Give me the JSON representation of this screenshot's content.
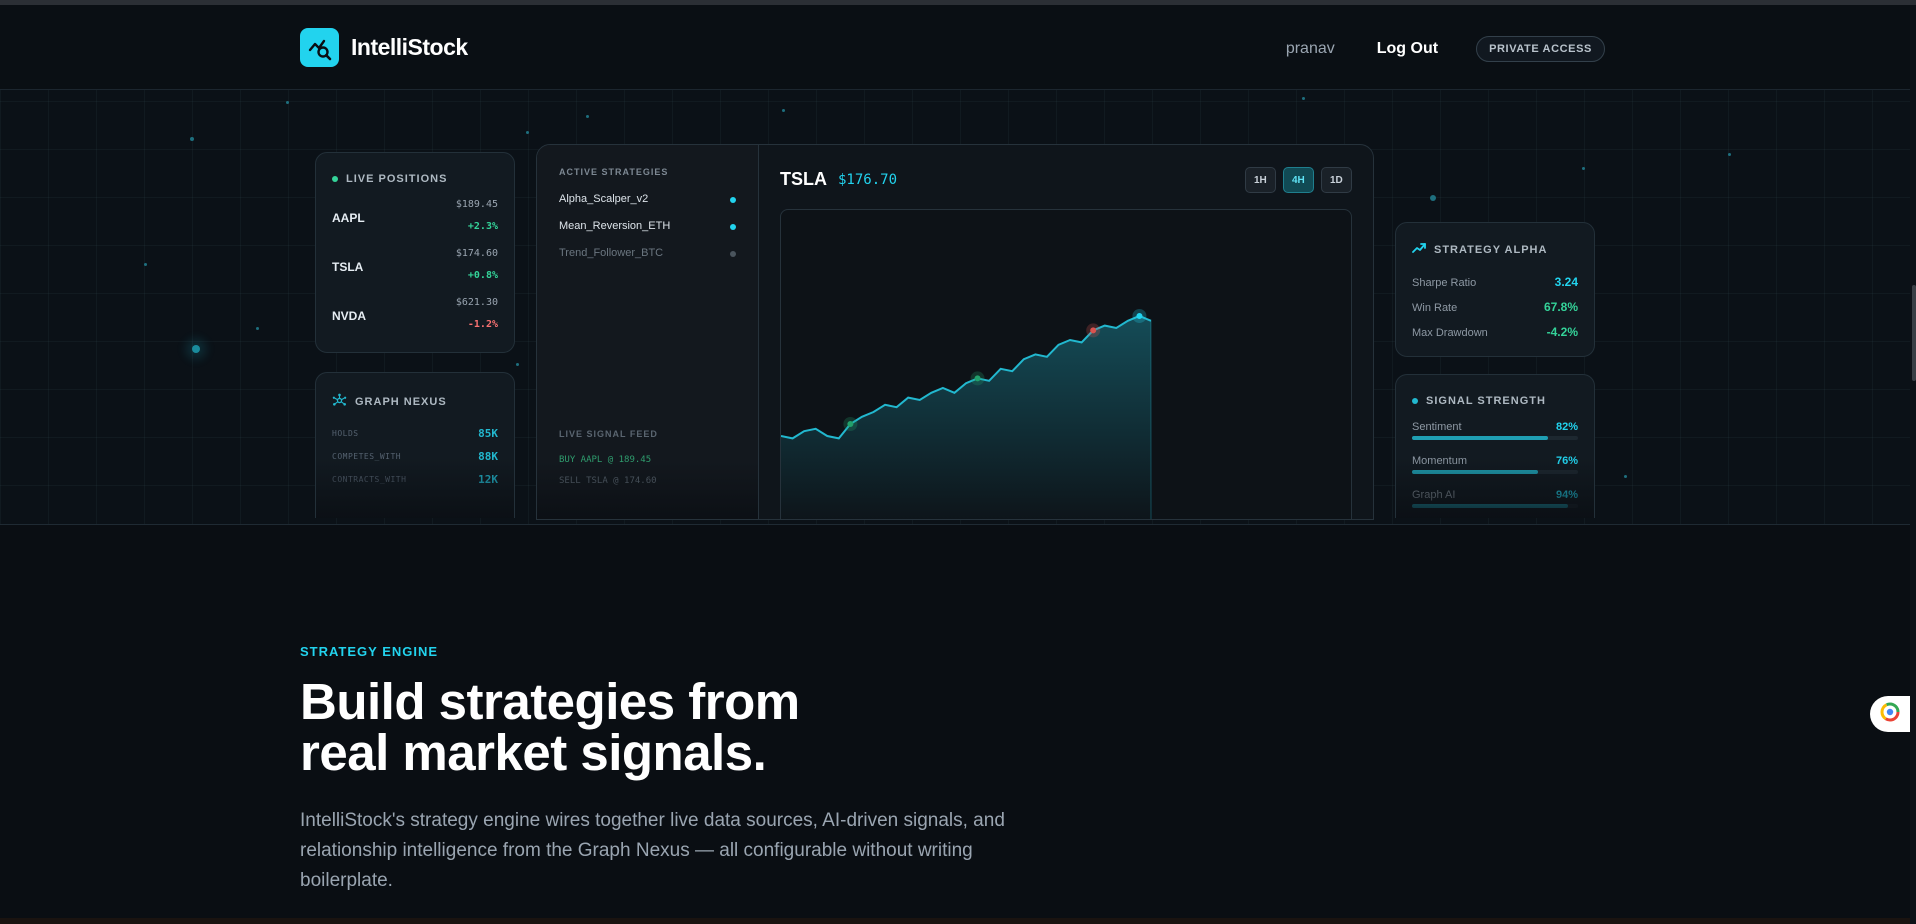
{
  "header": {
    "brand": "IntelliStock",
    "user": "pranav",
    "logout": "Log Out",
    "private_access": "PRIVATE ACCESS"
  },
  "live_positions": {
    "title": "LIVE POSITIONS",
    "items": [
      {
        "symbol": "AAPL",
        "price": "$189.45",
        "change": "+2.3%"
      },
      {
        "symbol": "TSLA",
        "price": "$174.60",
        "change": "+0.8%"
      },
      {
        "symbol": "NVDA",
        "price": "$621.30",
        "change": "-1.2%"
      }
    ]
  },
  "graph_nexus": {
    "title": "GRAPH NEXUS",
    "items": [
      {
        "label": "HOLDS",
        "value": "85K"
      },
      {
        "label": "COMPETES_WITH",
        "value": "88K"
      },
      {
        "label": "CONTRACTS_WITH",
        "value": "12K"
      }
    ]
  },
  "strategies": {
    "title": "ACTIVE STRATEGIES",
    "items": [
      {
        "name": "Alpha_Scalper_v2"
      },
      {
        "name": "Mean_Reversion_ETH"
      },
      {
        "name": "Trend_Follower_BTC"
      }
    ]
  },
  "signal_feed": {
    "title": "LIVE SIGNAL FEED",
    "items": [
      "BUY AAPL @ 189.45",
      "SELL TSLA @ 174.60"
    ]
  },
  "chart": {
    "symbol": "TSLA",
    "price": "$176.70",
    "timeframes": [
      "1H",
      "4H",
      "1D"
    ],
    "active_timeframe": "4H"
  },
  "strategy_alpha": {
    "title": "STRATEGY ALPHA",
    "metrics": [
      {
        "label": "Sharpe Ratio",
        "value": "3.24",
        "color": "#22d3ee"
      },
      {
        "label": "Win Rate",
        "value": "67.8%",
        "color": "#34d399"
      },
      {
        "label": "Max Drawdown",
        "value": "-4.2%",
        "color": "#34d399"
      }
    ]
  },
  "signal_strength": {
    "title": "SIGNAL STRENGTH",
    "items": [
      {
        "label": "Sentiment",
        "value": "82%",
        "level": 0.82
      },
      {
        "label": "Momentum",
        "value": "76%",
        "level": 0.76
      },
      {
        "label": "Graph AI",
        "value": "94%",
        "level": 0.94
      }
    ]
  },
  "section": {
    "eyebrow": "STRATEGY ENGINE",
    "headline_line1": "Build strategies from",
    "headline_line2": "real market signals.",
    "body": "IntelliStock's strategy engine wires together live data sources, AI-driven signals, and relationship intelligence from the Graph Nexus — all configurable without writing boilerplate."
  },
  "colors": {
    "accent": "#22d3ee",
    "positive": "#34d399",
    "negative": "#f87171"
  },
  "chart_data": {
    "type": "area",
    "title": "",
    "xlabel": "",
    "ylabel": "",
    "x": [
      0,
      1,
      2,
      3,
      4,
      5,
      6,
      7,
      8,
      9,
      10,
      11,
      12,
      13,
      14,
      15,
      16,
      17,
      18,
      19,
      20,
      21,
      22,
      23,
      24,
      25,
      26,
      27,
      28,
      29,
      30,
      31,
      32
    ],
    "series": [
      {
        "values": [
          10,
          9,
          12,
          13,
          10,
          9,
          15,
          18,
          20,
          23,
          22,
          26,
          25,
          28,
          30,
          28,
          32,
          34,
          33,
          38,
          37,
          42,
          44,
          43,
          48,
          50,
          49,
          54,
          56,
          55,
          58,
          60,
          58
        ]
      }
    ],
    "markers": [
      {
        "x": 6,
        "kind": "buy"
      },
      {
        "x": 17,
        "kind": "buy"
      },
      {
        "x": 27,
        "kind": "sell"
      },
      {
        "x": 31,
        "kind": "current"
      }
    ],
    "ylim": [
      0,
      100
    ]
  }
}
